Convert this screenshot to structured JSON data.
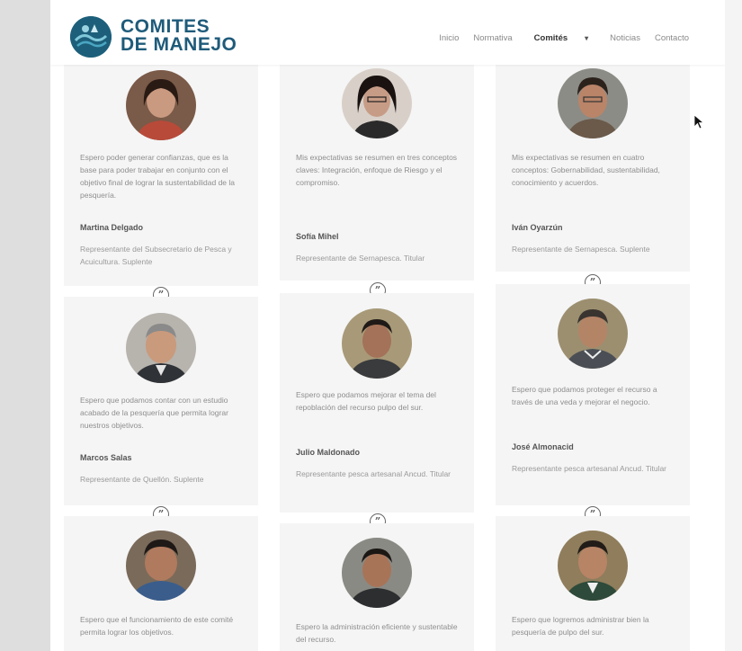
{
  "brand": {
    "line1": "COMITES",
    "line2": "DE MANEJO"
  },
  "nav": [
    {
      "label": "Inicio"
    },
    {
      "label": "Normativa"
    },
    {
      "label": "Comités",
      "active": true
    },
    {
      "label": "Noticias"
    },
    {
      "label": "Contacto"
    }
  ],
  "cards": [
    {
      "quote": "Espero poder generar confianzas, que es la base para poder trabajar en conjunto con el objetivo final de lograr la sustentabilidad de la pesquería.",
      "name": "Martina Delgado",
      "role": "Representante del Subsecretario de Pesca y Acuicultura. Suplente"
    },
    {
      "quote": "Mis expectativas se resumen en tres conceptos claves: Integración, enfoque de Riesgo y el compromiso.",
      "name": "Sofía Mihel",
      "role": "Representante de Sernapesca. Titular"
    },
    {
      "quote": "Mis expectativas se resumen en cuatro conceptos: Gobernabilidad, sustentabilidad, conocimiento y acuerdos.",
      "name": "Iván Oyarzún",
      "role": "Representante de Sernapesca. Suplente"
    },
    {
      "quote": "Espero que podamos contar con un estudio acabado de la pesquería que permita lograr nuestros objetivos.",
      "name": "Marcos Salas",
      "role": "Representante de Quellón. Suplente"
    },
    {
      "quote": "Espero que podamos mejorar el tema del repoblación del recurso pulpo del sur.",
      "name": "Julio Maldonado",
      "role": "Representante pesca artesanal Ancud. Titular"
    },
    {
      "quote": "Espero que podamos proteger el recurso a través de una veda y mejorar el negocio.",
      "name": "José Almonacid",
      "role": "Representante pesca artesanal Ancud. Titular"
    },
    {
      "quote": "Espero que el funcionamiento de este comité permita lograr los objetivos.",
      "name": "",
      "role": ""
    },
    {
      "quote": "Espero la administración eficiente y sustentable del recurso.",
      "name": "",
      "role": ""
    },
    {
      "quote": "Espero que logremos administrar bien la pesquería de pulpo del sur.",
      "name": "",
      "role": ""
    }
  ],
  "quote_icon": "quote-icon",
  "colors": {
    "brand": "#1e5b7a",
    "card_bg": "#f5f5f5",
    "text": "#8e8e8e"
  }
}
